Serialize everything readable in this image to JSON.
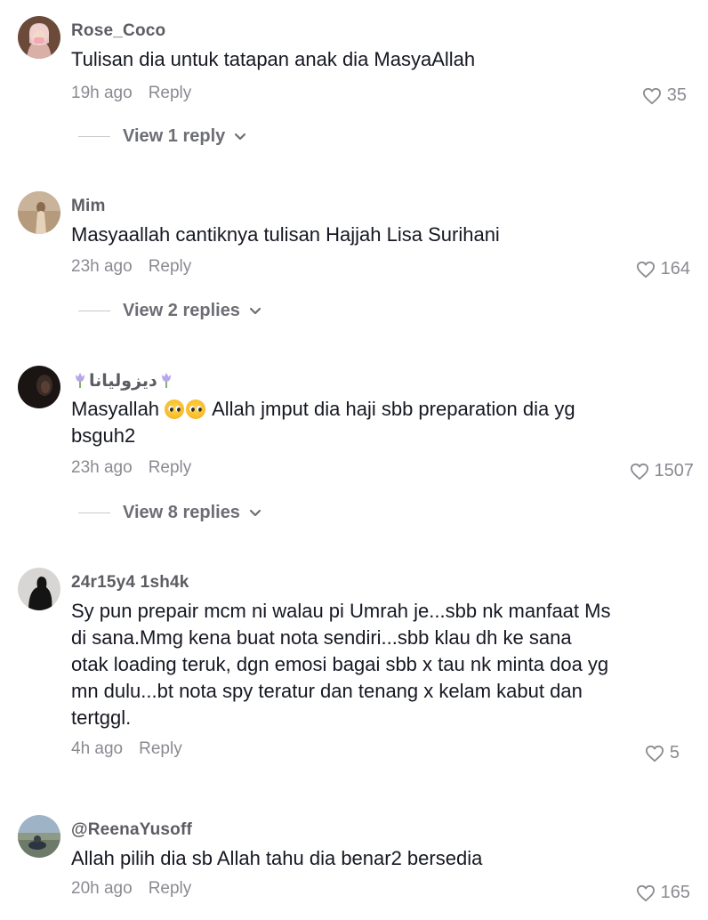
{
  "comments": [
    {
      "username": "Rose_Coco",
      "text": "Tulisan dia untuk tatapan anak dia MasyaAllah",
      "time": "19h ago",
      "reply_label": "Reply",
      "likes": "35",
      "view_replies": "View 1 reply"
    },
    {
      "username": "Mim",
      "text": "Masyaallah cantiknya tulisan Hajjah Lisa Surihani",
      "time": "23h ago",
      "reply_label": "Reply",
      "likes": "164",
      "view_replies": "View 2 replies"
    },
    {
      "username": "ديزوليانا",
      "text_before": "Masyallah",
      "text_after": "Allah jmput dia haji sbb preparation dia yg bsguh2",
      "time": "23h ago",
      "reply_label": "Reply",
      "likes": "1507",
      "view_replies": "View 8 replies"
    },
    {
      "username": "24r15y4 1sh4k",
      "text": "Sy pun prepair mcm ni walau pi Umrah je...sbb nk manfaat Ms di sana.Mmg kena buat nota sendiri...sbb klau dh ke sana otak loading teruk, dgn emosi bagai sbb x tau nk minta doa yg mn dulu...bt nota spy teratur dan tenang x kelam kabut dan tertggl.",
      "time": "4h ago",
      "reply_label": "Reply",
      "likes": "5"
    },
    {
      "username": "@ReenaYusoff",
      "text": "Allah pilih dia sb Allah tahu dia benar2 bersedia",
      "time": "20h ago",
      "reply_label": "Reply",
      "likes": "165"
    }
  ],
  "icons": {
    "like": "heart-outline-icon",
    "expand": "chevron-down-icon",
    "username_decoration": "tulip-icon"
  },
  "colors": {
    "username": "#5c5c63",
    "text": "#161823",
    "meta": "#8a8b91",
    "view_replies": "#6d6e75"
  }
}
